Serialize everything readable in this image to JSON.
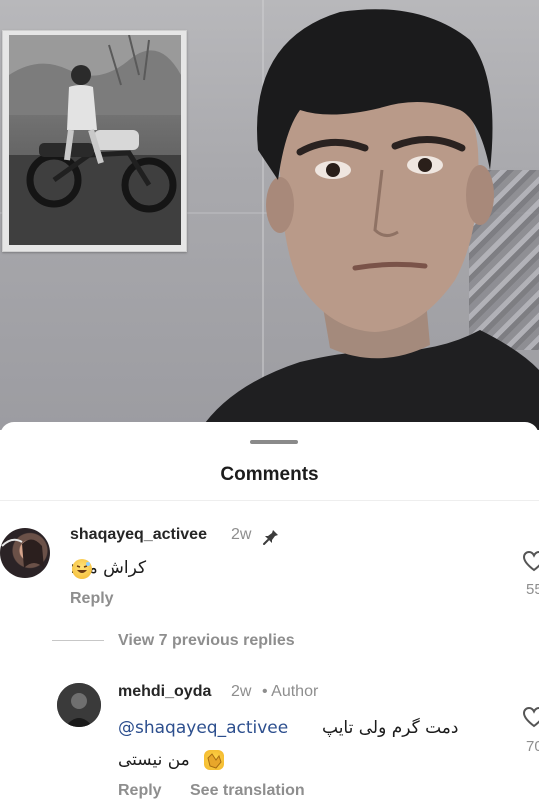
{
  "sheet": {
    "title": "Comments"
  },
  "comments": [
    {
      "username": "shaqayeq_activee",
      "time": "2w",
      "pinned": true,
      "text": "کراش من:",
      "reply_label": "Reply",
      "like_count": "55"
    }
  ],
  "view_replies_label": "View 7 previous replies",
  "reply": {
    "username": "mehdi_oyda",
    "time": "2w",
    "author_badge": "• Author",
    "mention": "@shaqayeq_activee",
    "text_line1": "دمت گرم ولی تایپ",
    "text_line2": "من نیستی",
    "reply_label": "Reply",
    "translate_label": "See translation",
    "like_count": "70"
  },
  "icons": {
    "pin": "pin-icon",
    "heart": "heart-outline-icon",
    "laugh_emoji": "grinning-sweat-emoji",
    "clap_emoji": "clapping-hands-emoji"
  },
  "colors": {
    "meta_gray": "#8e8e8e",
    "mention_blue": "#2d4f8e"
  }
}
